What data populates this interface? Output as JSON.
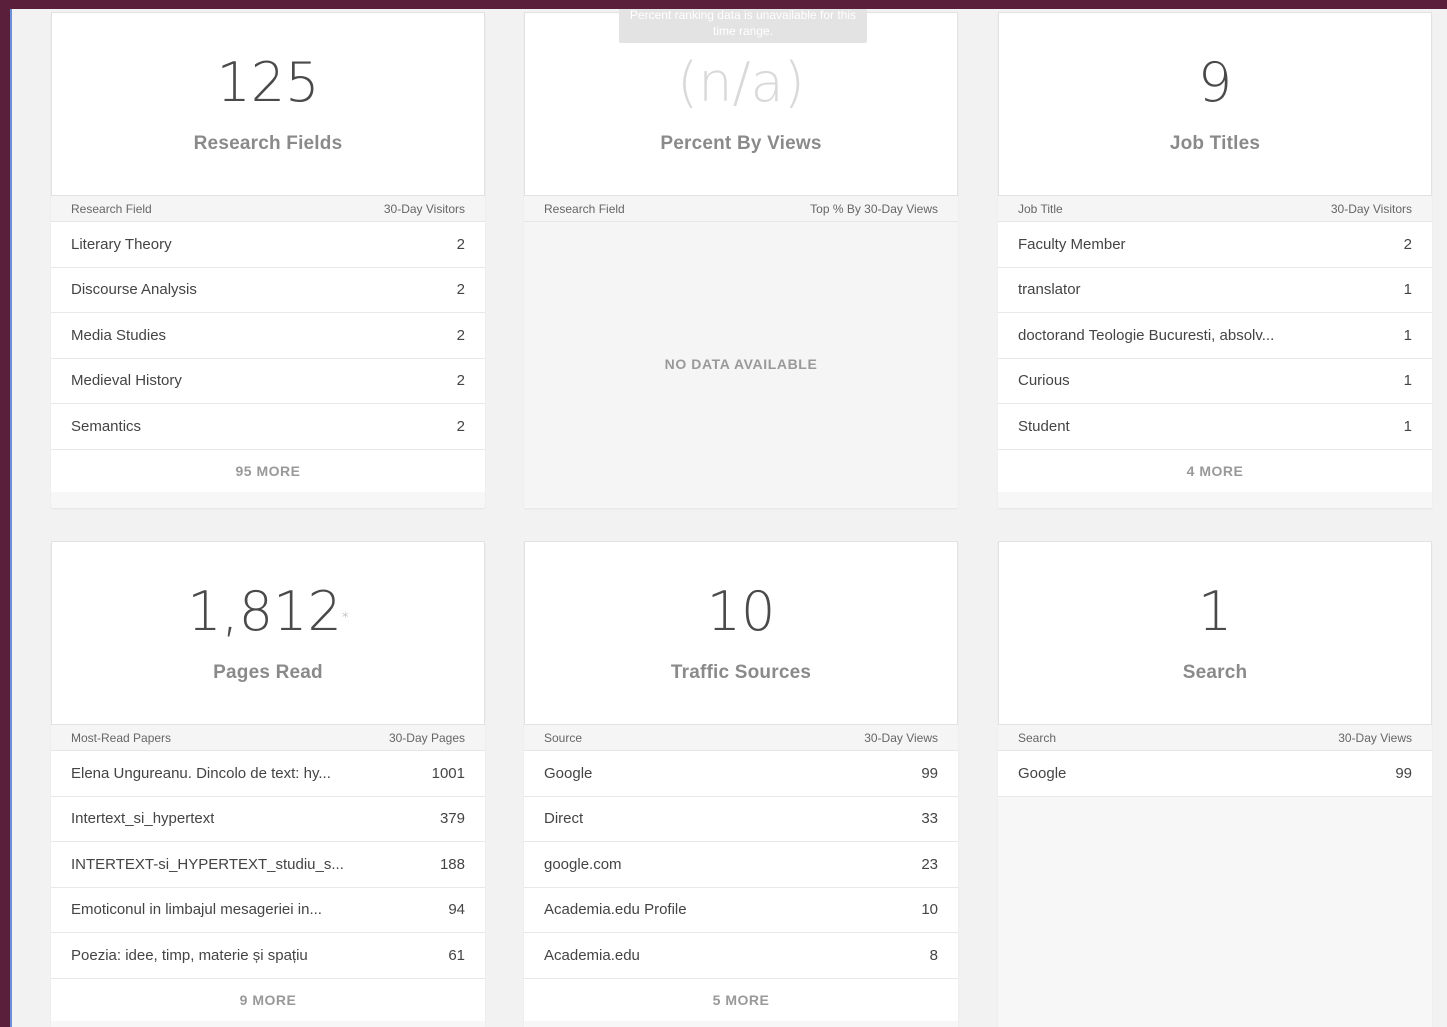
{
  "cards": {
    "research_fields": {
      "value": "125",
      "label": "Research Fields",
      "col_left": "Research Field",
      "col_right": "30-Day Visitors",
      "rows": [
        {
          "label": "Literary Theory",
          "value": "2"
        },
        {
          "label": "Discourse Analysis",
          "value": "2"
        },
        {
          "label": "Media Studies",
          "value": "2"
        },
        {
          "label": "Medieval History",
          "value": "2"
        },
        {
          "label": "Semantics",
          "value": "2"
        }
      ],
      "more": "95 MORE"
    },
    "percent_views": {
      "value": "(n/a)",
      "label": "Percent By Views",
      "tooltip": "Percent ranking data is unavailable for this time range.",
      "col_left": "Research Field",
      "col_right": "Top % By 30-Day Views",
      "empty": "NO DATA AVAILABLE"
    },
    "job_titles": {
      "value": "9",
      "label": "Job Titles",
      "col_left": "Job Title",
      "col_right": "30-Day Visitors",
      "rows": [
        {
          "label": "Faculty Member",
          "value": "2"
        },
        {
          "label": "translator",
          "value": "1"
        },
        {
          "label": "doctorand Teologie Bucuresti, absolv...",
          "value": "1"
        },
        {
          "label": "Curious",
          "value": "1"
        },
        {
          "label": "Student",
          "value": "1"
        }
      ],
      "more": "4 MORE"
    },
    "pages_read": {
      "value": "1,812",
      "marker": "*",
      "label": "Pages Read",
      "col_left": "Most-Read Papers",
      "col_right": "30-Day Pages",
      "rows": [
        {
          "label": "Elena Ungureanu. Dincolo de text: hy...",
          "value": "1001"
        },
        {
          "label": "Intertext_si_hypertext",
          "value": "379"
        },
        {
          "label": "INTERTEXT-si_HYPERTEXT_studiu_s...",
          "value": "188"
        },
        {
          "label": "Emoticonul in limbajul mesageriei in...",
          "value": "94"
        },
        {
          "label": "Poezia: idee, timp, materie și spațiu",
          "value": "61"
        }
      ],
      "more": "9 MORE"
    },
    "traffic_sources": {
      "value": "10",
      "label": "Traffic Sources",
      "col_left": "Source",
      "col_right": "30-Day Views",
      "rows": [
        {
          "label": "Google",
          "value": "99"
        },
        {
          "label": "Direct",
          "value": "33"
        },
        {
          "label": "google.com",
          "value": "23"
        },
        {
          "label": "Academia.edu Profile",
          "value": "10"
        },
        {
          "label": "Academia.edu",
          "value": "8"
        }
      ],
      "more": "5 MORE"
    },
    "search": {
      "value": "1",
      "label": "Search",
      "col_left": "Search",
      "col_right": "30-Day Views",
      "rows": [
        {
          "label": "Google",
          "value": "99"
        }
      ]
    }
  }
}
